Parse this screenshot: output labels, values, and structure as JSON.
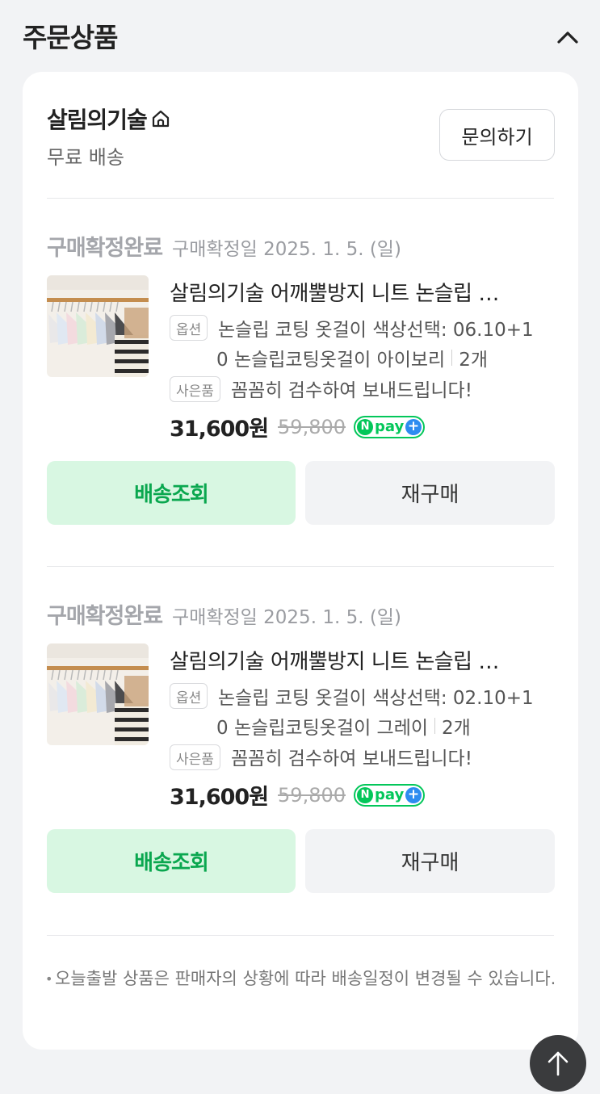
{
  "section": {
    "title": "주문상품"
  },
  "seller": {
    "name": "살림의기술",
    "shipping": "무료 배송",
    "inquiry_label": "문의하기"
  },
  "orders": [
    {
      "status": "구매확정완료",
      "confirm_date": "구매확정일 2025. 1. 5. (일)",
      "product_name": "살림의기술 어깨뿔방지 니트 논슬립 …",
      "option_tag": "옵션",
      "option_line1": "논슬립 코팅 옷걸이 색상선택: 06.10+1",
      "option_line2": "0 논슬립코팅옷걸이 아이보리",
      "quantity": "2개",
      "gift_tag": "사은품",
      "gift_text": "꼼꼼히 검수하여 보내드립니다!",
      "price": "31,600원",
      "original_price": "59,800",
      "npay_label": "pay",
      "track_label": "배송조회",
      "rebuy_label": "재구매"
    },
    {
      "status": "구매확정완료",
      "confirm_date": "구매확정일 2025. 1. 5. (일)",
      "product_name": "살림의기술 어깨뿔방지 니트 논슬립 …",
      "option_tag": "옵션",
      "option_line1": "논슬립 코팅 옷걸이 색상선택: 02.10+1",
      "option_line2": "0 논슬립코팅옷걸이 그레이",
      "quantity": "2개",
      "gift_tag": "사은품",
      "gift_text": "꼼꼼히 검수하여 보내드립니다!",
      "price": "31,600원",
      "original_price": "59,800",
      "npay_label": "pay",
      "track_label": "배송조회",
      "rebuy_label": "재구매"
    }
  ],
  "notice": {
    "bullet": "•",
    "text": "오늘출발 상품은 판매자의 상황에 따라 배송일정이 변경될 수 있습니다."
  },
  "colors": {
    "accent_green": "#0aa74f",
    "track_bg": "#d8f7e2",
    "npay_green": "#03c75a",
    "npay_blue": "#2d8cf0"
  },
  "icons": {
    "collapse": "chevron-up-icon",
    "home": "home-icon",
    "scroll_top": "arrow-up-icon"
  }
}
